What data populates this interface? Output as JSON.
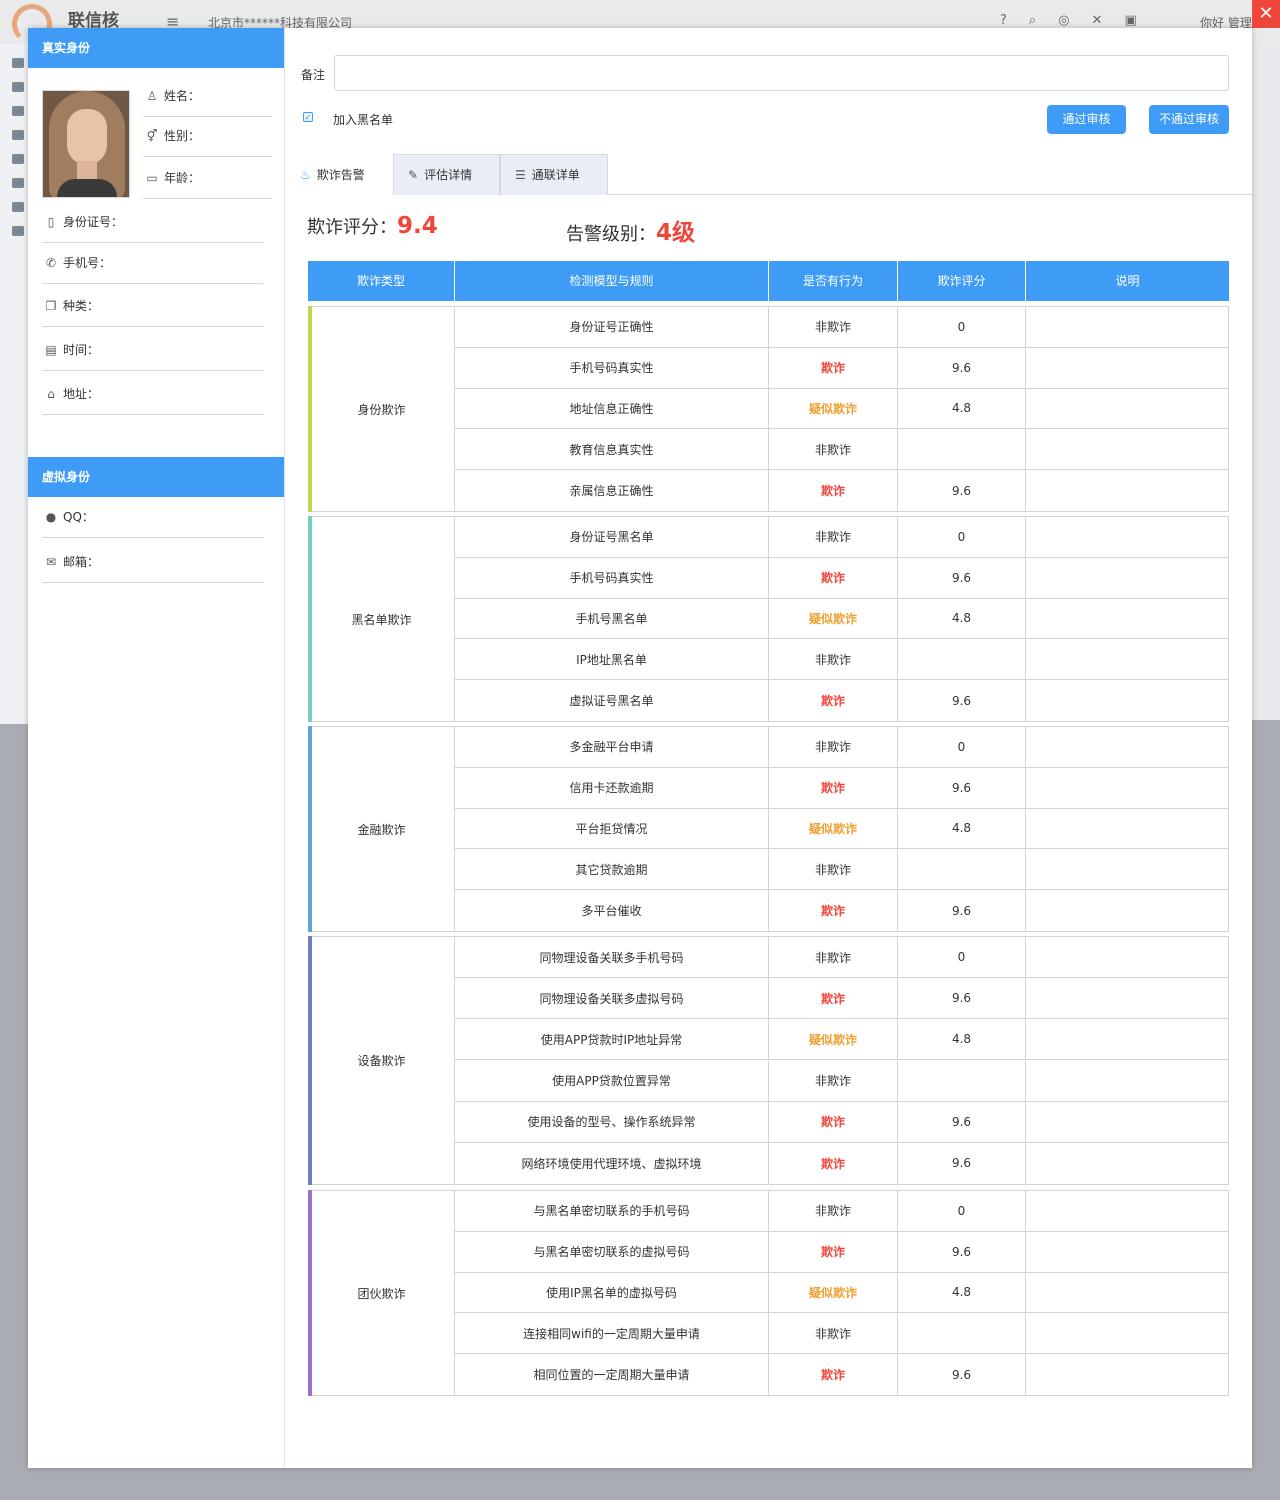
{
  "app": {
    "brand": "联信核",
    "company": "北京市******科技有限公司",
    "user": "你好 管理员",
    "close": "✕"
  },
  "real_identity": {
    "title": "真实身份",
    "fields": [
      {
        "icon": "user-icon",
        "label": "姓名："
      },
      {
        "icon": "gender-icon",
        "label": "性别："
      },
      {
        "icon": "calendar-icon",
        "label": "年龄："
      },
      {
        "icon": "id-card-icon",
        "label": "身份证号："
      },
      {
        "icon": "phone-icon",
        "label": "手机号："
      },
      {
        "icon": "copy-icon",
        "label": "种类："
      },
      {
        "icon": "calendar-icon",
        "label": "时间："
      },
      {
        "icon": "home-icon",
        "label": "地址："
      }
    ]
  },
  "virtual_identity": {
    "title": "虚拟身份",
    "fields": [
      {
        "icon": "qq-icon",
        "label": "QQ："
      },
      {
        "icon": "mail-icon",
        "label": "邮箱："
      }
    ]
  },
  "form": {
    "remark_label": "备注",
    "remark_value": "",
    "blacklist_label": "加入黑名单",
    "blacklist_checked": true,
    "approve_label": "通过审核",
    "reject_label": "不通过审核"
  },
  "tabs": [
    {
      "label": "欺诈告警",
      "icon": "alarm-icon",
      "active": true
    },
    {
      "label": "评估详情",
      "icon": "edit-icon",
      "active": false
    },
    {
      "label": "通联详单",
      "icon": "list-icon",
      "active": false
    }
  ],
  "summary": {
    "score_label": "欺诈评分：",
    "score_value": "9.4",
    "level_label": "告警级别：",
    "level_value": "4级"
  },
  "table": {
    "headers": [
      "欺诈类型",
      "检测模型与规则",
      "是否有行为",
      "欺诈评分",
      "说明"
    ],
    "groups": [
      {
        "name": "身份欺诈",
        "color": "#c5d64a",
        "rows": [
          {
            "rule": "身份证号正确性",
            "status": "非欺诈",
            "level": "ok",
            "score": "0",
            "note": ""
          },
          {
            "rule": "手机号码真实性",
            "status": "欺诈",
            "level": "fraud",
            "score": "9.6",
            "note": ""
          },
          {
            "rule": "地址信息正确性",
            "status": "疑似欺诈",
            "level": "sus",
            "score": "4.8",
            "note": ""
          },
          {
            "rule": "教育信息真实性",
            "status": "非欺诈",
            "level": "ok",
            "score": "",
            "note": ""
          },
          {
            "rule": "亲属信息正确性",
            "status": "欺诈",
            "level": "fraud",
            "score": "9.6",
            "note": ""
          }
        ]
      },
      {
        "name": "黑名单欺诈",
        "color": "#74cfc6",
        "rows": [
          {
            "rule": "身份证号黑名单",
            "status": "非欺诈",
            "level": "ok",
            "score": "0",
            "note": ""
          },
          {
            "rule": "手机号码真实性",
            "status": "欺诈",
            "level": "fraud",
            "score": "9.6",
            "note": ""
          },
          {
            "rule": "手机号黑名单",
            "status": "疑似欺诈",
            "level": "sus",
            "score": "4.8",
            "note": ""
          },
          {
            "rule": "IP地址黑名单",
            "status": "非欺诈",
            "level": "ok",
            "score": "",
            "note": ""
          },
          {
            "rule": "虚拟证号黑名单",
            "status": "欺诈",
            "level": "fraud",
            "score": "9.6",
            "note": ""
          }
        ]
      },
      {
        "name": "金融欺诈",
        "color": "#5aa7d6",
        "rows": [
          {
            "rule": "多金融平台申请",
            "status": "非欺诈",
            "level": "ok",
            "score": "0",
            "note": ""
          },
          {
            "rule": "信用卡还款逾期",
            "status": "欺诈",
            "level": "fraud",
            "score": "9.6",
            "note": ""
          },
          {
            "rule": "平台拒贷情况",
            "status": "疑似欺诈",
            "level": "sus",
            "score": "4.8",
            "note": ""
          },
          {
            "rule": "其它贷款逾期",
            "status": "非欺诈",
            "level": "ok",
            "score": "",
            "note": ""
          },
          {
            "rule": "多平台催收",
            "status": "欺诈",
            "level": "fraud",
            "score": "9.6",
            "note": ""
          }
        ]
      },
      {
        "name": "设备欺诈",
        "color": "#6f7cc0",
        "rows": [
          {
            "rule": "同物理设备关联多手机号码",
            "status": "非欺诈",
            "level": "ok",
            "score": "0",
            "note": ""
          },
          {
            "rule": "同物理设备关联多虚拟号码",
            "status": "欺诈",
            "level": "fraud",
            "score": "9.6",
            "note": ""
          },
          {
            "rule": "使用APP贷款时IP地址异常",
            "status": "疑似欺诈",
            "level": "sus",
            "score": "4.8",
            "note": ""
          },
          {
            "rule": "使用APP贷款位置异常",
            "status": "非欺诈",
            "level": "ok",
            "score": "",
            "note": ""
          },
          {
            "rule": "使用设备的型号、操作系统异常",
            "status": "欺诈",
            "level": "fraud",
            "score": "9.6",
            "note": ""
          },
          {
            "rule": "网络环境使用代理环境、虚拟环境",
            "status": "欺诈",
            "level": "fraud",
            "score": "9.6",
            "note": ""
          }
        ]
      },
      {
        "name": "团伙欺诈",
        "color": "#9a6fd0",
        "rows": [
          {
            "rule": "与黑名单密切联系的手机号码",
            "status": "非欺诈",
            "level": "ok",
            "score": "0",
            "note": ""
          },
          {
            "rule": "与黑名单密切联系的虚拟号码",
            "status": "欺诈",
            "level": "fraud",
            "score": "9.6",
            "note": ""
          },
          {
            "rule": "使用IP黑名单的虚拟号码",
            "status": "疑似欺诈",
            "level": "sus",
            "score": "4.8",
            "note": ""
          },
          {
            "rule": "连接相同wifi的一定周期大量申请",
            "status": "非欺诈",
            "level": "ok",
            "score": "",
            "note": ""
          },
          {
            "rule": "相同位置的一定周期大量申请",
            "status": "欺诈",
            "level": "fraud",
            "score": "9.6",
            "note": ""
          }
        ]
      }
    ]
  }
}
